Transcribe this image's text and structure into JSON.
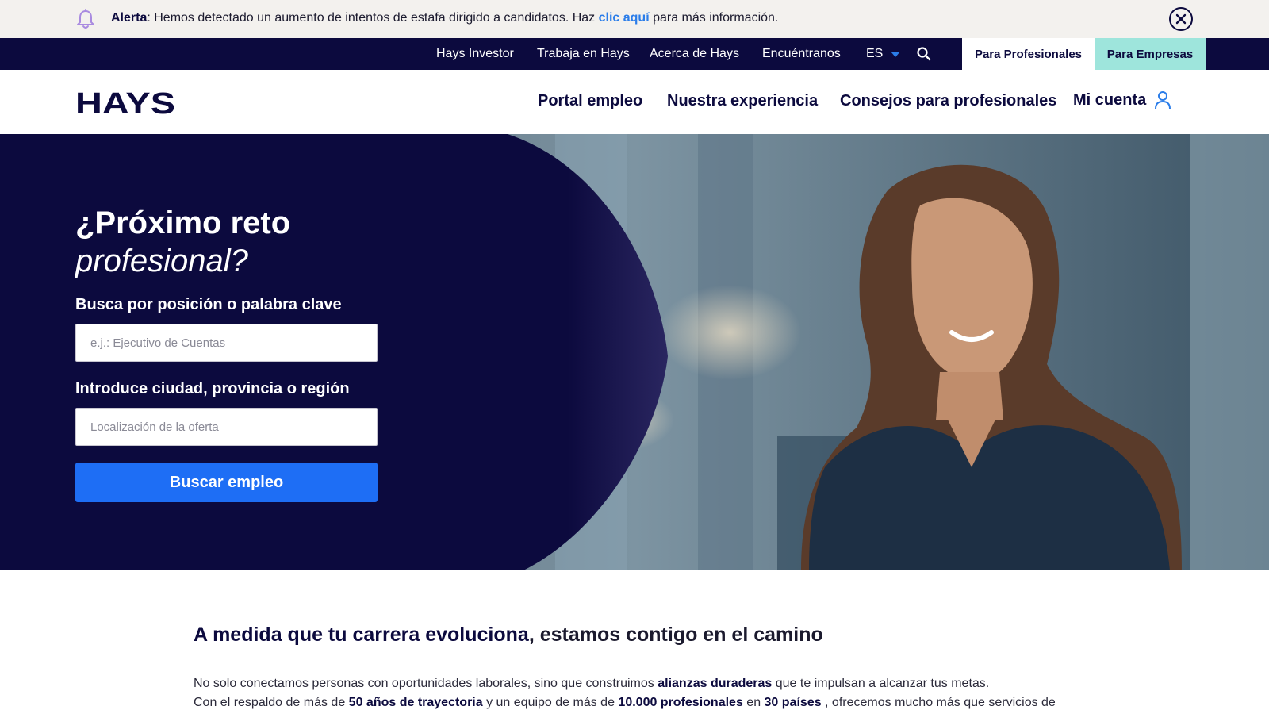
{
  "alert": {
    "label": "Alerta",
    "text_before": ": Hemos detectado un aumento de intentos de estafa dirigido a candidatos. Haz ",
    "link": "clic aquí",
    "text_after": " para más información.",
    "bell_icon": "bell-icon",
    "close_icon": "close-icon"
  },
  "top_nav": {
    "links": [
      "Hays Investor",
      "Trabaja en Hays",
      "Acerca de Hays",
      "Encuéntranos"
    ],
    "language": "ES",
    "search_icon": "search-icon",
    "tab_professionals": "Para Profesionales",
    "tab_companies": "Para Empresas"
  },
  "header": {
    "logo_text": "HAYS",
    "links": [
      "Portal empleo",
      "Nuestra experiencia",
      "Consejos para profesionales"
    ],
    "account": "Mi cuenta",
    "account_icon": "user-icon"
  },
  "hero": {
    "title_line1": "¿Próximo reto",
    "title_line2": "profesional?",
    "keyword_label": "Busca por posición o palabra clave",
    "keyword_placeholder": "e.j.: Ejecutivo de Cuentas",
    "location_label": "Introduce ciudad, provincia o región",
    "location_placeholder": "Localización de la oferta",
    "button": "Buscar empleo"
  },
  "intro": {
    "heading_bold": "A medida que tu carrera evoluciona",
    "heading_rest": ", estamos contigo en el camino",
    "p1_a": "No solo conectamos personas con oportunidades laborales, sino que construimos ",
    "p1_b": "alianzas duraderas",
    "p1_c": " que te impulsan a alcanzar tus metas.",
    "p2_a": "Con el respaldo de más de ",
    "p2_b": "50 años de trayectoria",
    "p2_c": " y un equipo de más de ",
    "p2_d": "10.000 profesionales",
    "p2_e": " en ",
    "p2_f": "30 países",
    "p2_g": " , ofrecemos mucho más que servicios de"
  },
  "colors": {
    "navy": "#0c0a3e",
    "accent_blue": "#1e6ef5",
    "link_blue": "#2b7de9",
    "mint": "#9ee5dc",
    "alert_bg": "#f3f1ee"
  }
}
